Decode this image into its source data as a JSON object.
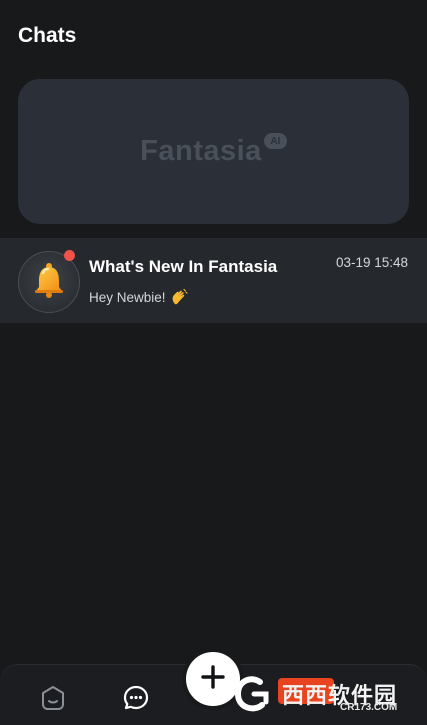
{
  "header": {
    "title": "Chats"
  },
  "banner": {
    "logo_text": "Fantasia",
    "logo_badge": "AI"
  },
  "chats": [
    {
      "name": "What's New In Fantasia",
      "time": "03-19 15:48",
      "preview": "Hey Newbie!",
      "avatar_icon": "bell-icon",
      "unread": true
    }
  ],
  "bottom_nav": {
    "items": [
      {
        "icon": "home-icon"
      },
      {
        "icon": "chat-bubble-icon",
        "active": true
      }
    ],
    "fab_icon": "plus-icon"
  },
  "watermark": {
    "brand_cn": "西西软件园",
    "url": "CR173.COM"
  },
  "colors": {
    "background": "#18191b",
    "banner": "#2b3038",
    "row": "#25282d",
    "unread_dot": "#f0524a",
    "fab": "#ffffff"
  }
}
